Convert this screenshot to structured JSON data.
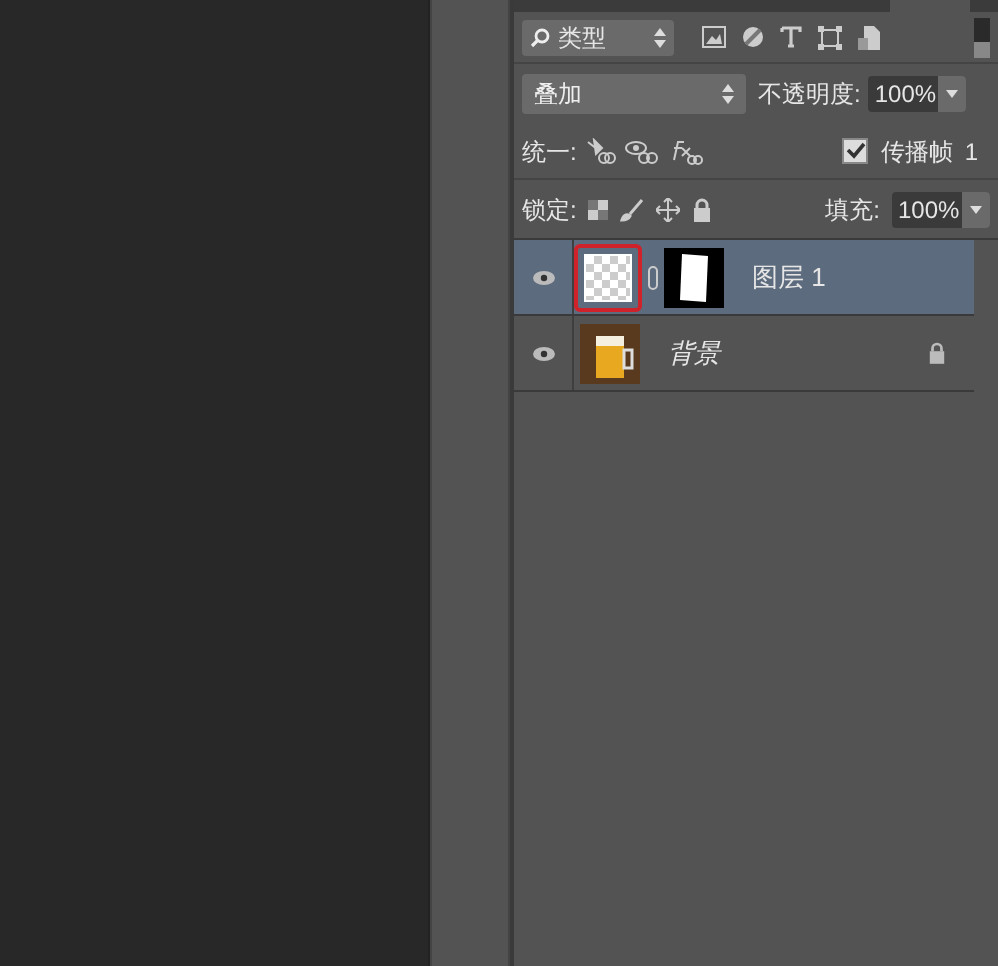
{
  "filter": {
    "kind_label": "类型"
  },
  "blend": {
    "mode": "叠加",
    "opacity_label": "不透明度:",
    "opacity": "100%"
  },
  "unify": {
    "label": "统一:",
    "propagate_label": "传播帧",
    "propagate_checked": true,
    "frame": "1"
  },
  "lock": {
    "label": "锁定:",
    "fill_label": "填充:",
    "fill": "100%"
  },
  "layers": [
    {
      "name": "图层 1",
      "kind": "masked",
      "visible": true,
      "selected": true,
      "locked": false,
      "highlighted": true
    },
    {
      "name": "背景",
      "kind": "background",
      "visible": true,
      "selected": false,
      "locked": true,
      "highlighted": false
    }
  ]
}
